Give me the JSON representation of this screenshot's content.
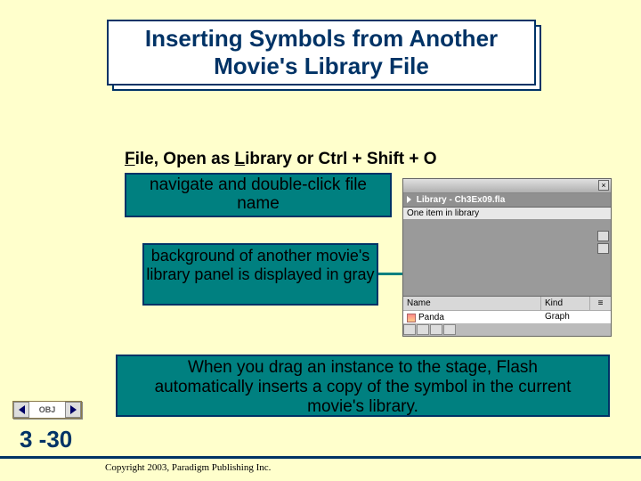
{
  "title": {
    "text": "Inserting Symbols from Another Movie's Library File"
  },
  "keyboard": {
    "prefix": "F",
    "seg1": "ile, Open as ",
    "letter2": "L",
    "seg2": "ibrary or Ctrl + Shift + O"
  },
  "callouts": {
    "navigate": "navigate and double-click file name",
    "background": "background of another movie's library panel is displayed in gray",
    "drag": "When you drag an instance to the stage, Flash automatically inserts a copy of the symbol in the current movie's library."
  },
  "panel": {
    "title": "Library - Ch3Ex09.fla",
    "stat": "One item in library",
    "headers": {
      "name": "Name",
      "kind": "Kind",
      "sort": "≡"
    },
    "row": {
      "name": "Panda",
      "kind": "Graph"
    },
    "close_label": "×"
  },
  "nav": {
    "obj_label": "OBJ",
    "slide": "3 -30"
  },
  "copyright": "Copyright 2003, Paradigm Publishing Inc."
}
